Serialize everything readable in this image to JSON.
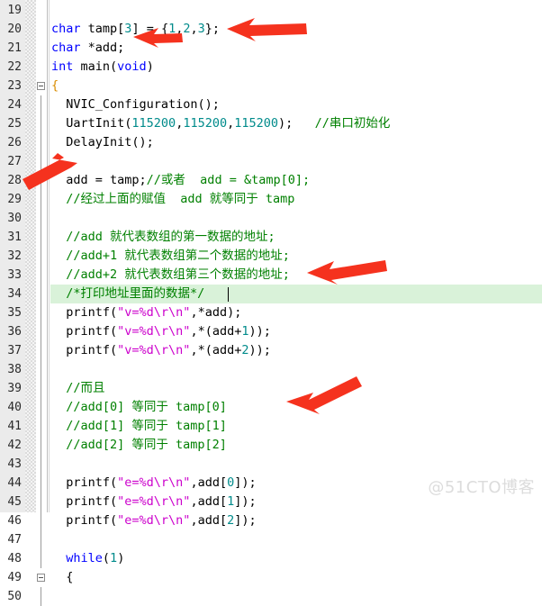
{
  "editor": {
    "app": "code-editor",
    "colors": {
      "background": "#ffffff",
      "gutter": "#ebebeb",
      "keyword": "#0000ff",
      "number": "#008b8b",
      "string": "#cc00cc",
      "comment": "#008000",
      "current_line": "#d9f2d9",
      "annotation_arrow": "#f5321e",
      "watermark": "#dcdcdc"
    },
    "first_line_number": 19,
    "last_line_number": 50,
    "current_line_number": 34,
    "lines": [
      {
        "n": "19",
        "fold": "none",
        "tokens": []
      },
      {
        "n": "20",
        "fold": "none",
        "tokens": [
          {
            "t": "char",
            "c": "kw"
          },
          {
            "t": " tamp[",
            "c": "pl"
          },
          {
            "t": "3",
            "c": "num"
          },
          {
            "t": "] = {",
            "c": "pl"
          },
          {
            "t": "1",
            "c": "num"
          },
          {
            "t": ",",
            "c": "pl"
          },
          {
            "t": "2",
            "c": "num"
          },
          {
            "t": ",",
            "c": "pl"
          },
          {
            "t": "3",
            "c": "num"
          },
          {
            "t": "};",
            "c": "pl"
          }
        ]
      },
      {
        "n": "21",
        "fold": "none",
        "tokens": [
          {
            "t": "char",
            "c": "kw"
          },
          {
            "t": " *add;",
            "c": "pl"
          }
        ]
      },
      {
        "n": "22",
        "fold": "none",
        "tokens": [
          {
            "t": "int",
            "c": "kw"
          },
          {
            "t": " main(",
            "c": "pl"
          },
          {
            "t": "void",
            "c": "kw"
          },
          {
            "t": ")",
            "c": "pl"
          }
        ]
      },
      {
        "n": "23",
        "fold": "box-open",
        "tokens": [
          {
            "t": "{",
            "c": "brace-hl"
          }
        ]
      },
      {
        "n": "24",
        "fold": "line",
        "tokens": [
          {
            "t": "  NVIC_Configuration();",
            "c": "pl"
          }
        ]
      },
      {
        "n": "25",
        "fold": "line",
        "tokens": [
          {
            "t": "  UartInit(",
            "c": "pl"
          },
          {
            "t": "115200",
            "c": "num"
          },
          {
            "t": ",",
            "c": "pl"
          },
          {
            "t": "115200",
            "c": "num"
          },
          {
            "t": ",",
            "c": "pl"
          },
          {
            "t": "115200",
            "c": "num"
          },
          {
            "t": ");   ",
            "c": "pl"
          },
          {
            "t": "//串口初始化",
            "c": "cmt"
          }
        ]
      },
      {
        "n": "26",
        "fold": "line",
        "tokens": [
          {
            "t": "  DelayInit();",
            "c": "pl"
          }
        ]
      },
      {
        "n": "27",
        "fold": "line",
        "tokens": []
      },
      {
        "n": "28",
        "fold": "line",
        "tokens": [
          {
            "t": "  add = tamp;",
            "c": "pl"
          },
          {
            "t": "//或者  add = &tamp[0];",
            "c": "cmt"
          }
        ]
      },
      {
        "n": "29",
        "fold": "line",
        "tokens": [
          {
            "t": "  //经过上面的赋值  add 就等同于 tamp",
            "c": "cmt"
          }
        ]
      },
      {
        "n": "30",
        "fold": "line",
        "tokens": []
      },
      {
        "n": "31",
        "fold": "line",
        "tokens": [
          {
            "t": "  //add 就代表数组的第一数据的地址;",
            "c": "cmt"
          }
        ]
      },
      {
        "n": "32",
        "fold": "line",
        "tokens": [
          {
            "t": "  //add+1 就代表数组第二个数据的地址;",
            "c": "cmt"
          }
        ]
      },
      {
        "n": "33",
        "fold": "line",
        "tokens": [
          {
            "t": "  //add+2 就代表数组第三个数据的地址;",
            "c": "cmt"
          }
        ]
      },
      {
        "n": "34",
        "fold": "line",
        "tokens": [
          {
            "t": "  /*打印地址里面的数据*/",
            "c": "cmt"
          }
        ]
      },
      {
        "n": "35",
        "fold": "line",
        "tokens": [
          {
            "t": "  printf(",
            "c": "pl"
          },
          {
            "t": "\"v=%d\\r\\n\"",
            "c": "str"
          },
          {
            "t": ",*add);",
            "c": "pl"
          }
        ]
      },
      {
        "n": "36",
        "fold": "line",
        "tokens": [
          {
            "t": "  printf(",
            "c": "pl"
          },
          {
            "t": "\"v=%d\\r\\n\"",
            "c": "str"
          },
          {
            "t": ",*(add+",
            "c": "pl"
          },
          {
            "t": "1",
            "c": "num"
          },
          {
            "t": "));",
            "c": "pl"
          }
        ]
      },
      {
        "n": "37",
        "fold": "line",
        "tokens": [
          {
            "t": "  printf(",
            "c": "pl"
          },
          {
            "t": "\"v=%d\\r\\n\"",
            "c": "str"
          },
          {
            "t": ",*(add+",
            "c": "pl"
          },
          {
            "t": "2",
            "c": "num"
          },
          {
            "t": "));",
            "c": "pl"
          }
        ]
      },
      {
        "n": "38",
        "fold": "line",
        "tokens": []
      },
      {
        "n": "39",
        "fold": "line",
        "tokens": [
          {
            "t": "  //而且",
            "c": "cmt"
          }
        ]
      },
      {
        "n": "40",
        "fold": "line",
        "tokens": [
          {
            "t": "  //add[0] 等同于 tamp[0]",
            "c": "cmt"
          }
        ]
      },
      {
        "n": "41",
        "fold": "line",
        "tokens": [
          {
            "t": "  //add[1] 等同于 tamp[1]",
            "c": "cmt"
          }
        ]
      },
      {
        "n": "42",
        "fold": "line",
        "tokens": [
          {
            "t": "  //add[2] 等同于 tamp[2]",
            "c": "cmt"
          }
        ]
      },
      {
        "n": "43",
        "fold": "line",
        "tokens": []
      },
      {
        "n": "44",
        "fold": "line",
        "tokens": [
          {
            "t": "  printf(",
            "c": "pl"
          },
          {
            "t": "\"e=%d\\r\\n\"",
            "c": "str"
          },
          {
            "t": ",add[",
            "c": "pl"
          },
          {
            "t": "0",
            "c": "num"
          },
          {
            "t": "]);",
            "c": "pl"
          }
        ]
      },
      {
        "n": "45",
        "fold": "line",
        "tokens": [
          {
            "t": "  printf(",
            "c": "pl"
          },
          {
            "t": "\"e=%d\\r\\n\"",
            "c": "str"
          },
          {
            "t": ",add[",
            "c": "pl"
          },
          {
            "t": "1",
            "c": "num"
          },
          {
            "t": "]);",
            "c": "pl"
          }
        ]
      },
      {
        "n": "46",
        "fold": "line",
        "tokens": [
          {
            "t": "  printf(",
            "c": "pl"
          },
          {
            "t": "\"e=%d\\r\\n\"",
            "c": "str"
          },
          {
            "t": ",add[",
            "c": "pl"
          },
          {
            "t": "2",
            "c": "num"
          },
          {
            "t": "]);",
            "c": "pl"
          }
        ]
      },
      {
        "n": "47",
        "fold": "line",
        "tokens": []
      },
      {
        "n": "48",
        "fold": "line",
        "tokens": [
          {
            "t": "  ",
            "c": "pl"
          },
          {
            "t": "while",
            "c": "kw"
          },
          {
            "t": "(",
            "c": "pl"
          },
          {
            "t": "1",
            "c": "num"
          },
          {
            "t": ")",
            "c": "pl"
          }
        ]
      },
      {
        "n": "49",
        "fold": "box-open",
        "tokens": [
          {
            "t": "  {",
            "c": "pl"
          }
        ]
      },
      {
        "n": "50",
        "fold": "line",
        "tokens": []
      }
    ],
    "annotations": [
      {
        "name": "arrow-to-line-20",
        "target_line": "20"
      },
      {
        "name": "arrow-to-line-21",
        "target_line": "21"
      },
      {
        "name": "arrow-to-line-29",
        "target_line": "29"
      },
      {
        "name": "arrow-to-line-35",
        "target_line": "35"
      },
      {
        "name": "arrow-to-line-44",
        "target_line": "44"
      }
    ]
  },
  "watermark": {
    "text": "@51CTO博客"
  }
}
